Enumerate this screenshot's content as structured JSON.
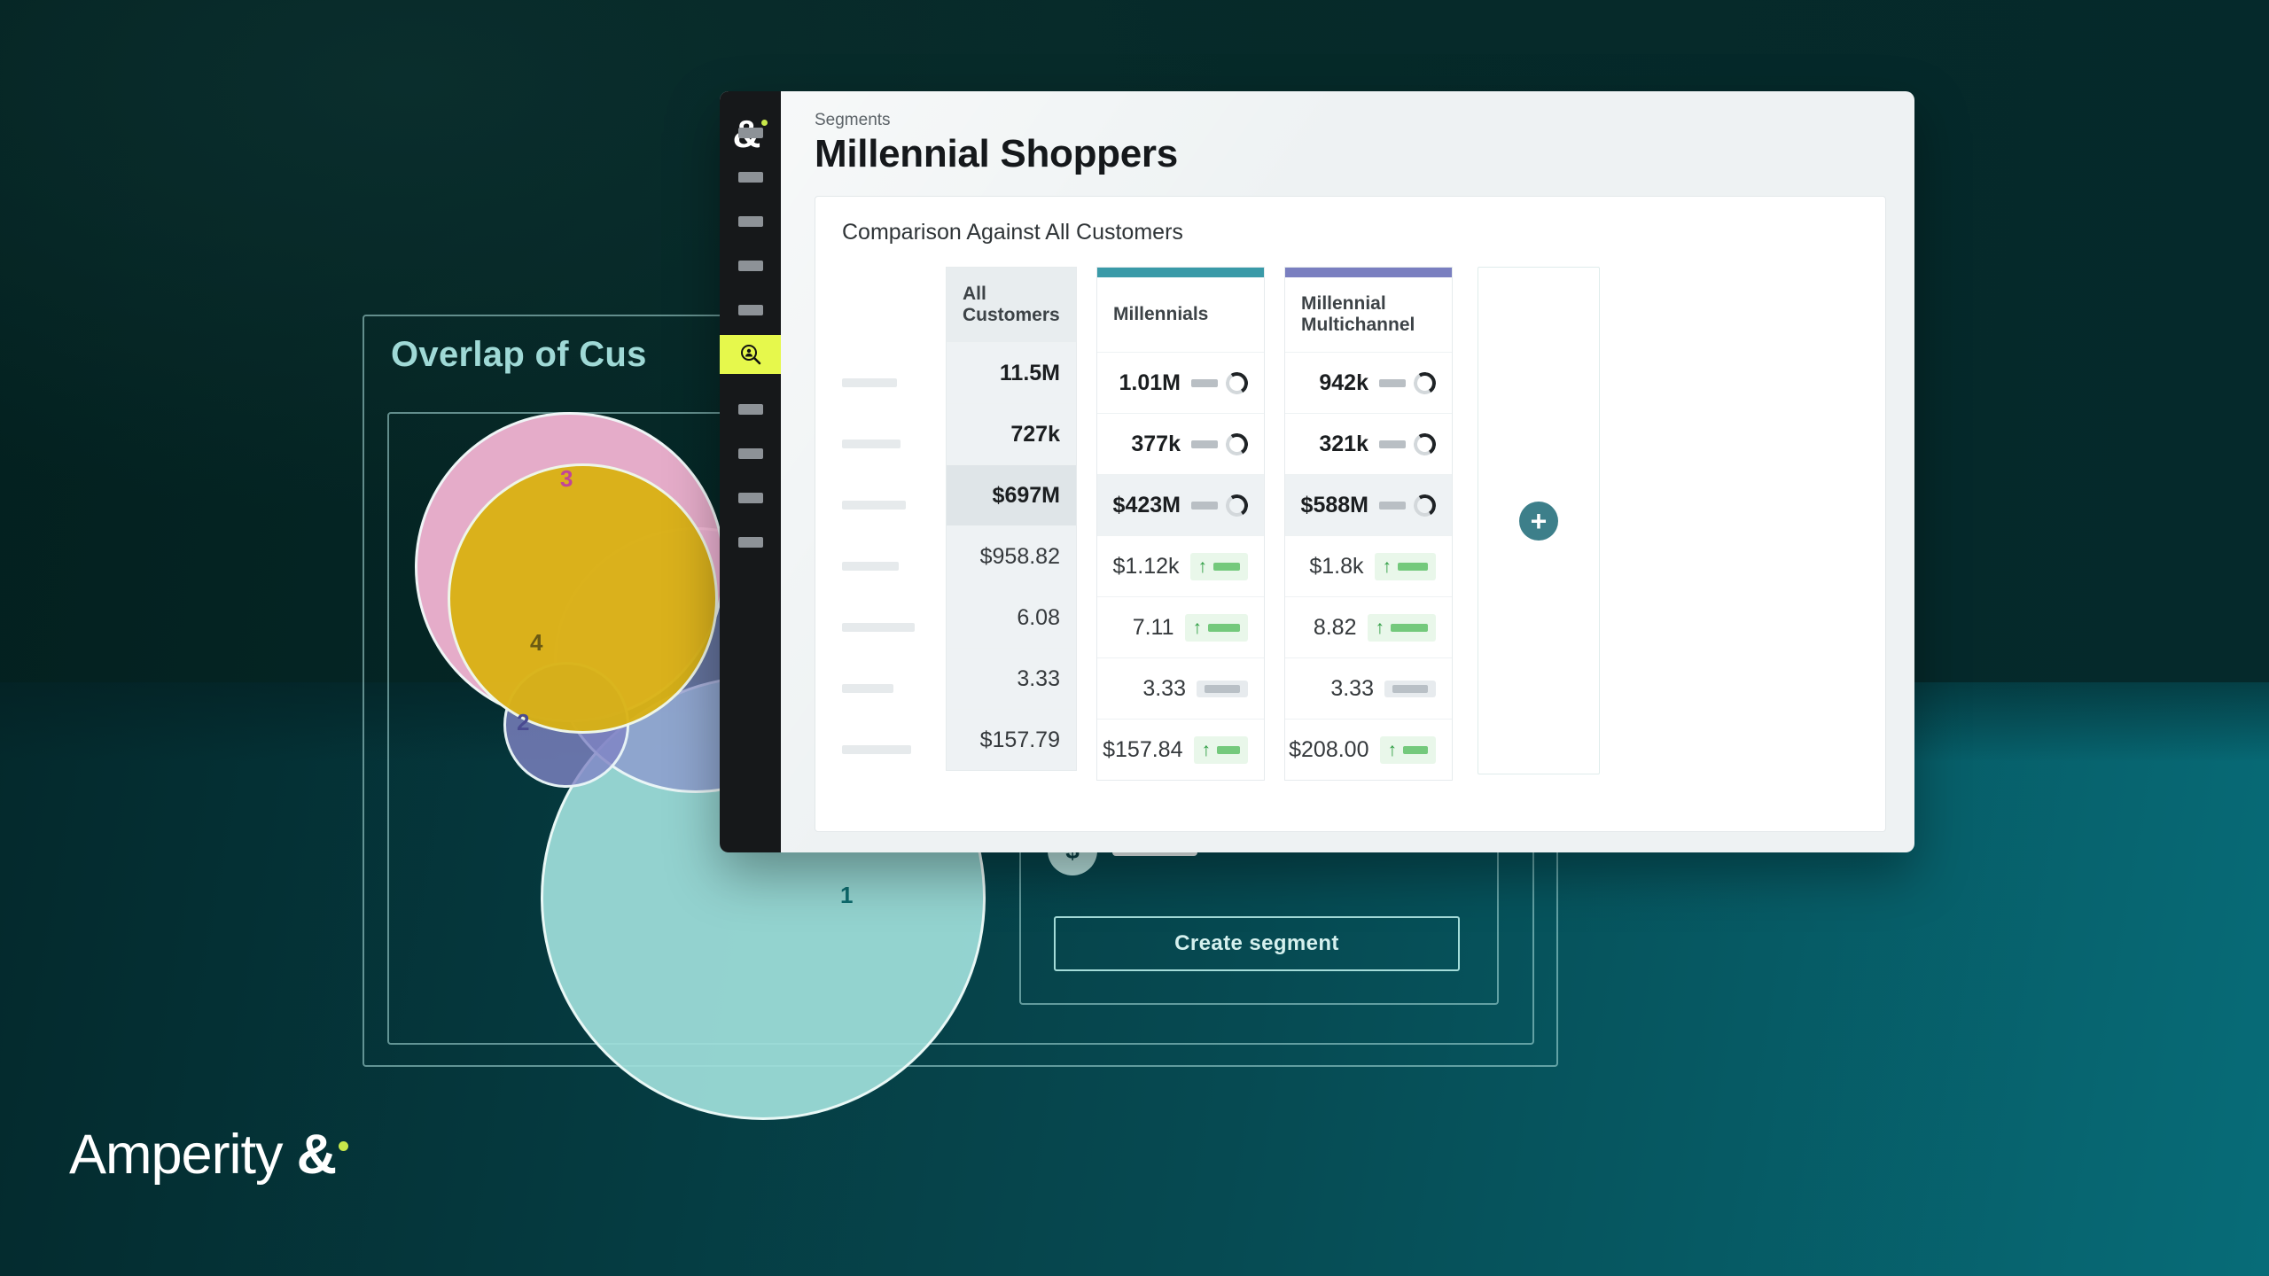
{
  "brand": {
    "name": "Amperity",
    "ampersand": "&",
    "accent_dot_color": "#c8e84a",
    "logo_color": "#ffffff"
  },
  "background": {
    "top_color": "#062a29",
    "bottom_color": "#076c78"
  },
  "overlap_panel": {
    "title": "Overlap of Cus",
    "title_color": "#9fd9d6",
    "create_segment_label": "Create segment",
    "dollar_icon": "dollar-sign-icon"
  },
  "chart_data": {
    "type": "venn",
    "title": "Overlap of Cus",
    "sets": [
      {
        "label": "1",
        "color": "#a0e0db",
        "label_color": "#0d6b6e"
      },
      {
        "label": "2",
        "color": "#7f83c4",
        "label_color": "#4a4b91"
      },
      {
        "label": "3",
        "color": "#f6b7d6",
        "label_color": "#c2449a"
      },
      {
        "label": "4",
        "color": "#d9b112",
        "label_color": "#6b5a13"
      }
    ]
  },
  "sidebar": {
    "logo_icon": "ampersand-logo-icon",
    "items": [
      {
        "name": "nav-placeholder-1",
        "icon": "placeholder-icon",
        "active": false
      },
      {
        "name": "nav-placeholder-2",
        "icon": "placeholder-icon",
        "active": false
      },
      {
        "name": "nav-placeholder-3",
        "icon": "placeholder-icon",
        "active": false
      },
      {
        "name": "nav-placeholder-4",
        "icon": "placeholder-icon",
        "active": false
      },
      {
        "name": "nav-placeholder-5",
        "icon": "placeholder-icon",
        "active": false
      },
      {
        "name": "nav-segments",
        "icon": "segment-search-icon",
        "active": true
      },
      {
        "name": "nav-placeholder-6",
        "icon": "placeholder-icon",
        "active": false
      },
      {
        "name": "nav-placeholder-7",
        "icon": "placeholder-icon",
        "active": false
      },
      {
        "name": "nav-placeholder-8",
        "icon": "placeholder-icon",
        "active": false
      },
      {
        "name": "nav-placeholder-9",
        "icon": "placeholder-icon",
        "active": false
      }
    ],
    "active_color": "#e6f84c"
  },
  "header": {
    "breadcrumb": "Segments",
    "title": "Millennial Shoppers"
  },
  "panel": {
    "title": "Comparison Against All Customers",
    "add_column_icon": "plus-icon",
    "row_label_widths": [
      62,
      66,
      72,
      64,
      82,
      58,
      78
    ]
  },
  "table": {
    "columns": [
      {
        "header": "All Customers",
        "accent": null
      },
      {
        "header": "Millennials",
        "accent": "#3a9aa8"
      },
      {
        "header": "Millennial Multichannel",
        "accent": "#7a7fc0"
      }
    ],
    "rows": [
      {
        "highlight": false,
        "bold": true,
        "all_customers": "11.5M",
        "millennials": {
          "value": "1.01M",
          "trend": "neutral",
          "bar": 30
        },
        "multichannel": {
          "value": "942k",
          "trend": "neutral",
          "bar": 30
        }
      },
      {
        "highlight": false,
        "bold": true,
        "all_customers": "727k",
        "millennials": {
          "value": "377k",
          "trend": "neutral",
          "bar": 30
        },
        "multichannel": {
          "value": "321k",
          "trend": "neutral",
          "bar": 30
        }
      },
      {
        "highlight": true,
        "bold": true,
        "all_customers": "$697M",
        "millennials": {
          "value": "$423M",
          "trend": "neutral",
          "bar": 30
        },
        "multichannel": {
          "value": "$588M",
          "trend": "neutral",
          "bar": 30
        }
      },
      {
        "highlight": false,
        "bold": false,
        "all_customers": "$958.82",
        "millennials": {
          "value": "$1.12k",
          "trend": "up",
          "bar": 30
        },
        "multichannel": {
          "value": "$1.8k",
          "trend": "up",
          "bar": 34
        }
      },
      {
        "highlight": false,
        "bold": false,
        "all_customers": "6.08",
        "millennials": {
          "value": "7.11",
          "trend": "up",
          "bar": 36
        },
        "multichannel": {
          "value": "8.82",
          "trend": "up",
          "bar": 42
        }
      },
      {
        "highlight": false,
        "bold": false,
        "all_customers": "3.33",
        "millennials": {
          "value": "3.33",
          "trend": "flat",
          "bar": 40
        },
        "multichannel": {
          "value": "3.33",
          "trend": "flat",
          "bar": 40
        }
      },
      {
        "highlight": false,
        "bold": false,
        "all_customers": "$157.79",
        "millennials": {
          "value": "$157.84",
          "trend": "up",
          "bar": 26
        },
        "multichannel": {
          "value": "$208.00",
          "trend": "up",
          "bar": 28
        }
      }
    ]
  }
}
